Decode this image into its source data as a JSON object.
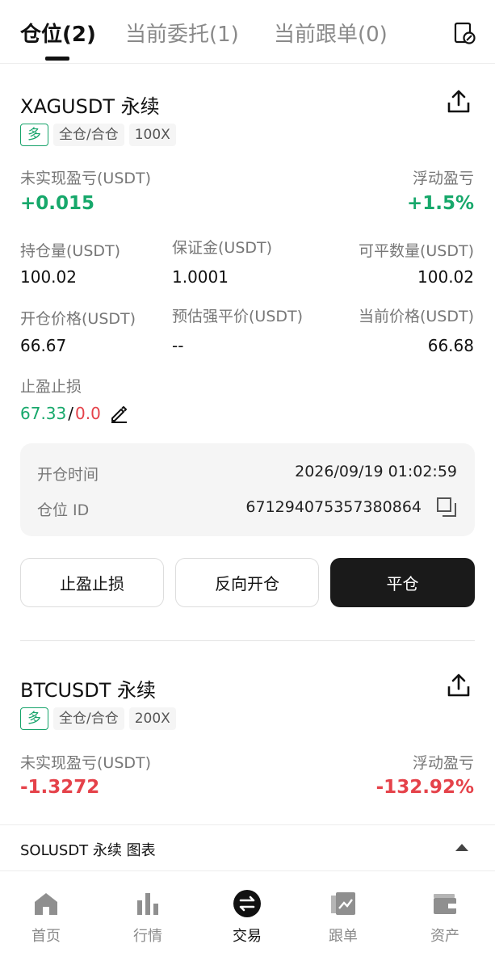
{
  "tabs": [
    {
      "label": "仓位(2)",
      "active": true
    },
    {
      "label": "当前委托(1)",
      "active": false
    },
    {
      "label": "当前跟单(0)",
      "active": false
    }
  ],
  "positions": [
    {
      "symbol": "XAGUSDT 永续",
      "side": "多",
      "margin_mode": "全仓/合仓",
      "leverage": "100X",
      "unrealized_label": "未实现盈亏(USDT)",
      "unrealized_value": "+0.015",
      "float_label": "浮动盈亏",
      "float_value": "+1.5%",
      "size_label": "持仓量(USDT)",
      "size_value": "100.02",
      "margin_label": "保证金(USDT)",
      "margin_value": "1.0001",
      "closable_label": "可平数量(USDT)",
      "closable_value": "100.02",
      "entry_label": "开仓价格(USDT)",
      "entry_value": "66.67",
      "liq_label": "预估强平价(USDT)",
      "liq_value": "--",
      "mark_label": "当前价格(USDT)",
      "mark_value": "66.68",
      "tpsl_label": "止盈止损",
      "tp_value": "67.33",
      "tpsl_sep": "/",
      "sl_value": "0.0",
      "open_time_label": "开仓时间",
      "open_time_value": "2026/09/19 01:02:59",
      "position_id_label": "仓位 ID",
      "position_id_value": "671294075357380864",
      "btn_tpsl": "止盈止损",
      "btn_reverse": "反向开仓",
      "btn_close": "平仓"
    },
    {
      "symbol": "BTCUSDT 永续",
      "side": "多",
      "margin_mode": "全仓/合仓",
      "leverage": "200X",
      "unrealized_label": "未实现盈亏(USDT)",
      "unrealized_value": "-1.3272",
      "float_label": "浮动盈亏",
      "float_value": "-132.92%"
    }
  ],
  "mini_chart": {
    "label": "SOLUSDT 永续 图表"
  },
  "bottom_nav": [
    {
      "label": "首页",
      "icon": "home-icon",
      "active": false
    },
    {
      "label": "行情",
      "icon": "market-chart-icon",
      "active": false
    },
    {
      "label": "交易",
      "icon": "trade-swap-icon",
      "active": true
    },
    {
      "label": "跟单",
      "icon": "copy-trade-icon",
      "active": false
    },
    {
      "label": "资产",
      "icon": "wallet-icon",
      "active": false
    }
  ],
  "colors": {
    "profit": "#17a86b",
    "loss": "#e5424a",
    "primary_button": "#1a1a1a"
  }
}
